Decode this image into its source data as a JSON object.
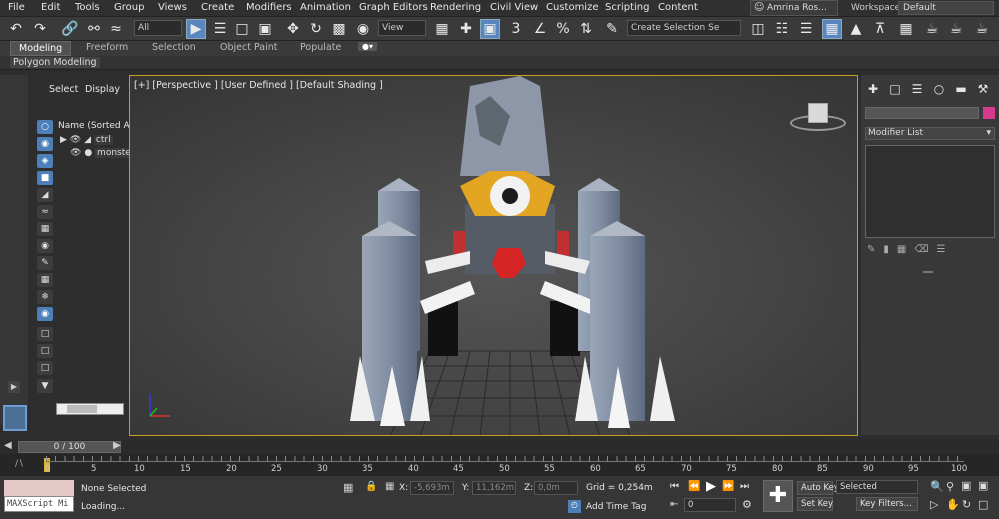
{
  "menubar": {
    "items": [
      "File",
      "Edit",
      "Tools",
      "Group",
      "Views",
      "Create",
      "Modifiers",
      "Animation",
      "Graph Editors",
      "Rendering",
      "Civil View",
      "Customize",
      "Scripting",
      "Content"
    ],
    "user": "Amrina Ros...",
    "workspaces_label": "Workspaces:",
    "workspace_value": "Default"
  },
  "toolbar": {
    "filter_value": "All",
    "view_value": "View",
    "selection_set_value": "Create Selection Se"
  },
  "ribbon": {
    "tabs": [
      "Modeling",
      "Freeform",
      "Selection",
      "Object Paint",
      "Populate"
    ],
    "panel_label": "Polygon Modeling"
  },
  "scene_explorer": {
    "tab_select": "Select",
    "tab_display": "Display",
    "column_header": "Name (Sorted Asce",
    "rows": [
      "ctrl",
      "monster"
    ]
  },
  "viewport": {
    "label": "[+] [Perspective ] [User Defined ] [Default Shading ]"
  },
  "command_panel": {
    "modifier_list": "Modifier List",
    "swatch_color": "#d63a8c"
  },
  "timeline": {
    "slider_text": "0 / 100",
    "ticks": [
      "0",
      "5",
      "10",
      "15",
      "20",
      "25",
      "30",
      "35",
      "40",
      "45",
      "50",
      "55",
      "60",
      "65",
      "70",
      "75",
      "80",
      "85",
      "90",
      "95",
      "100"
    ]
  },
  "status": {
    "maxscript": "MAXScript Mi",
    "selection": "None Selected",
    "loading": "Loading...",
    "x_label": "X:",
    "x_value": "-5,693m",
    "y_label": "Y:",
    "y_value": "11,162m",
    "z_label": "Z:",
    "z_value": "0,0m",
    "grid": "Grid = 0,254m",
    "add_time_tag": "Add Time Tag",
    "frame_value": "0",
    "auto_key": "Auto Key",
    "set_key": "Set Key",
    "key_mode": "Selected",
    "key_filters": "Key Filters..."
  },
  "colors": {
    "accent": "#5a86c0",
    "viewport_border": "#c8a020"
  }
}
